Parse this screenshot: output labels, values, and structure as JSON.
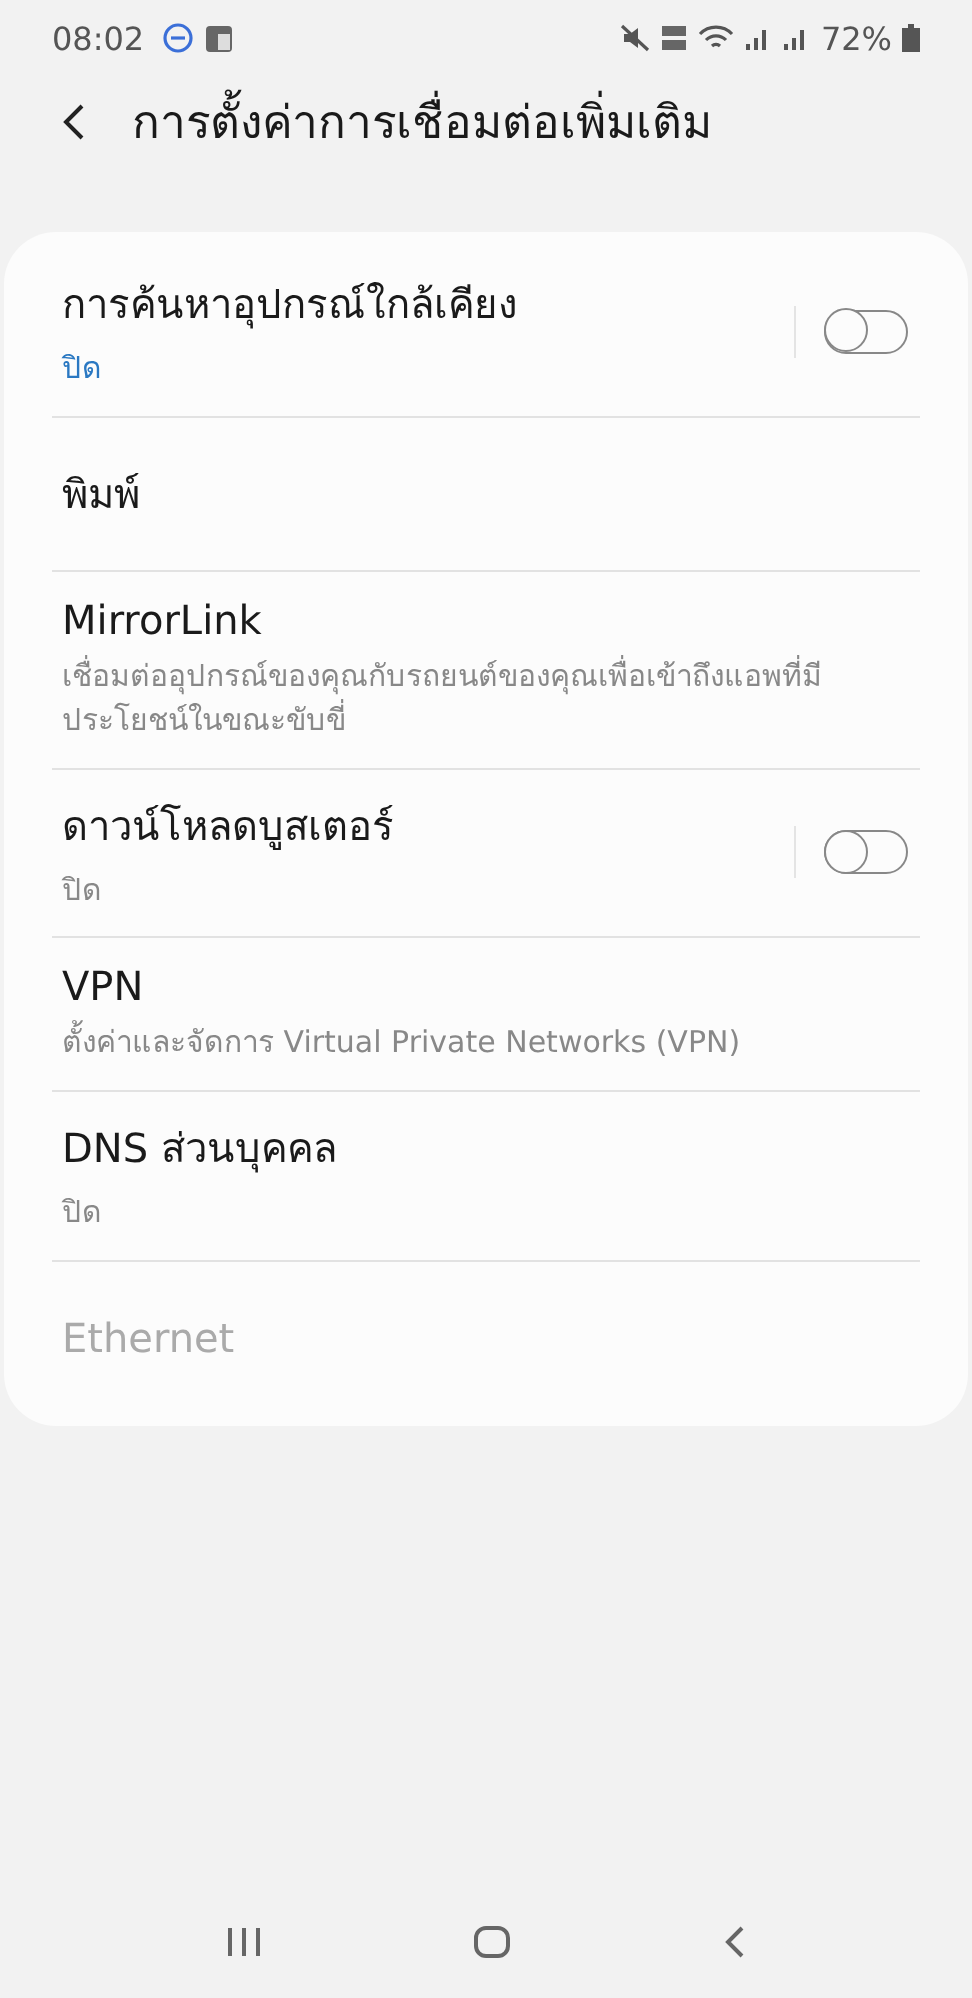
{
  "status_bar": {
    "time": "08:02",
    "battery": "72%"
  },
  "header": {
    "title": "การตั้งค่าการเชื่อมต่อเพิ่มเติม"
  },
  "items": [
    {
      "kind": "toggle",
      "title": "การค้นหาอุปกรณ์ใกล้เคียง",
      "summary": "ปิด",
      "summary_highlighted": true,
      "on": false,
      "disabled": false
    },
    {
      "kind": "plain",
      "title": "พิมพ์",
      "disabled": false
    },
    {
      "kind": "plain",
      "title": "MirrorLink",
      "summary": "เชื่อมต่ออุปกรณ์ของคุณกับรถยนต์ของคุณเพื่อเข้าถึงแอพที่มีประโยชน์ในขณะขับขี่",
      "summary_highlighted": false,
      "disabled": false
    },
    {
      "kind": "toggle",
      "title": "ดาวน์โหลดบูสเตอร์",
      "summary": "ปิด",
      "summary_highlighted": false,
      "on": false,
      "disabled": false
    },
    {
      "kind": "plain",
      "title": "VPN",
      "summary": "ตั้งค่าและจัดการ Virtual Private Networks (VPN)",
      "summary_highlighted": false,
      "disabled": false
    },
    {
      "kind": "plain",
      "title": "DNS ส่วนบุคคล",
      "summary": "ปิด",
      "summary_highlighted": false,
      "disabled": false
    },
    {
      "kind": "plain",
      "title": "Ethernet",
      "disabled": true
    }
  ]
}
